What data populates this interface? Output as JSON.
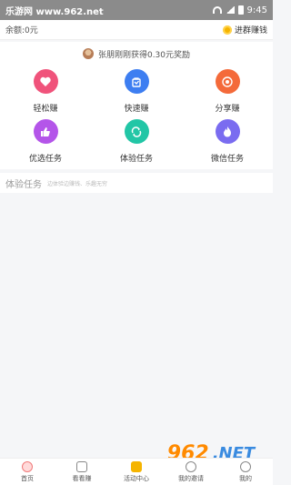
{
  "status_bar": {
    "left_text": "乐游网 www.962.net",
    "time": "9:45"
  },
  "balance": {
    "text": "余额:0元",
    "join_group": "进群赚钱"
  },
  "notice": {
    "text": "张朋刚刚获得0.30元奖励"
  },
  "features": [
    {
      "label": "轻松赚",
      "icon": "heart-icon",
      "color": "#f0537b"
    },
    {
      "label": "快速赚",
      "icon": "bag-icon",
      "color": "#3d7ef1"
    },
    {
      "label": "分享赚",
      "icon": "camera-shutter-icon",
      "color": "#f46a3a"
    },
    {
      "label": "优选任务",
      "icon": "thumbs-up-icon",
      "color": "#b455e9"
    },
    {
      "label": "体验任务",
      "icon": "recycle-icon",
      "color": "#22c6a6"
    },
    {
      "label": "微信任务",
      "icon": "flame-icon",
      "color": "#7a6cf0"
    }
  ],
  "experience_tasks": {
    "title": "体验任务",
    "subtitle": "边体验边赚钱、乐趣无穷"
  },
  "bottom_nav": [
    {
      "label": "首页"
    },
    {
      "label": "看看赚"
    },
    {
      "label": "活动中心"
    },
    {
      "label": "我的邀请"
    },
    {
      "label": "我的"
    }
  ],
  "watermark": {
    "brand_number": "962",
    "brand_suffix": ".NET",
    "brand_name": "乐游网"
  }
}
